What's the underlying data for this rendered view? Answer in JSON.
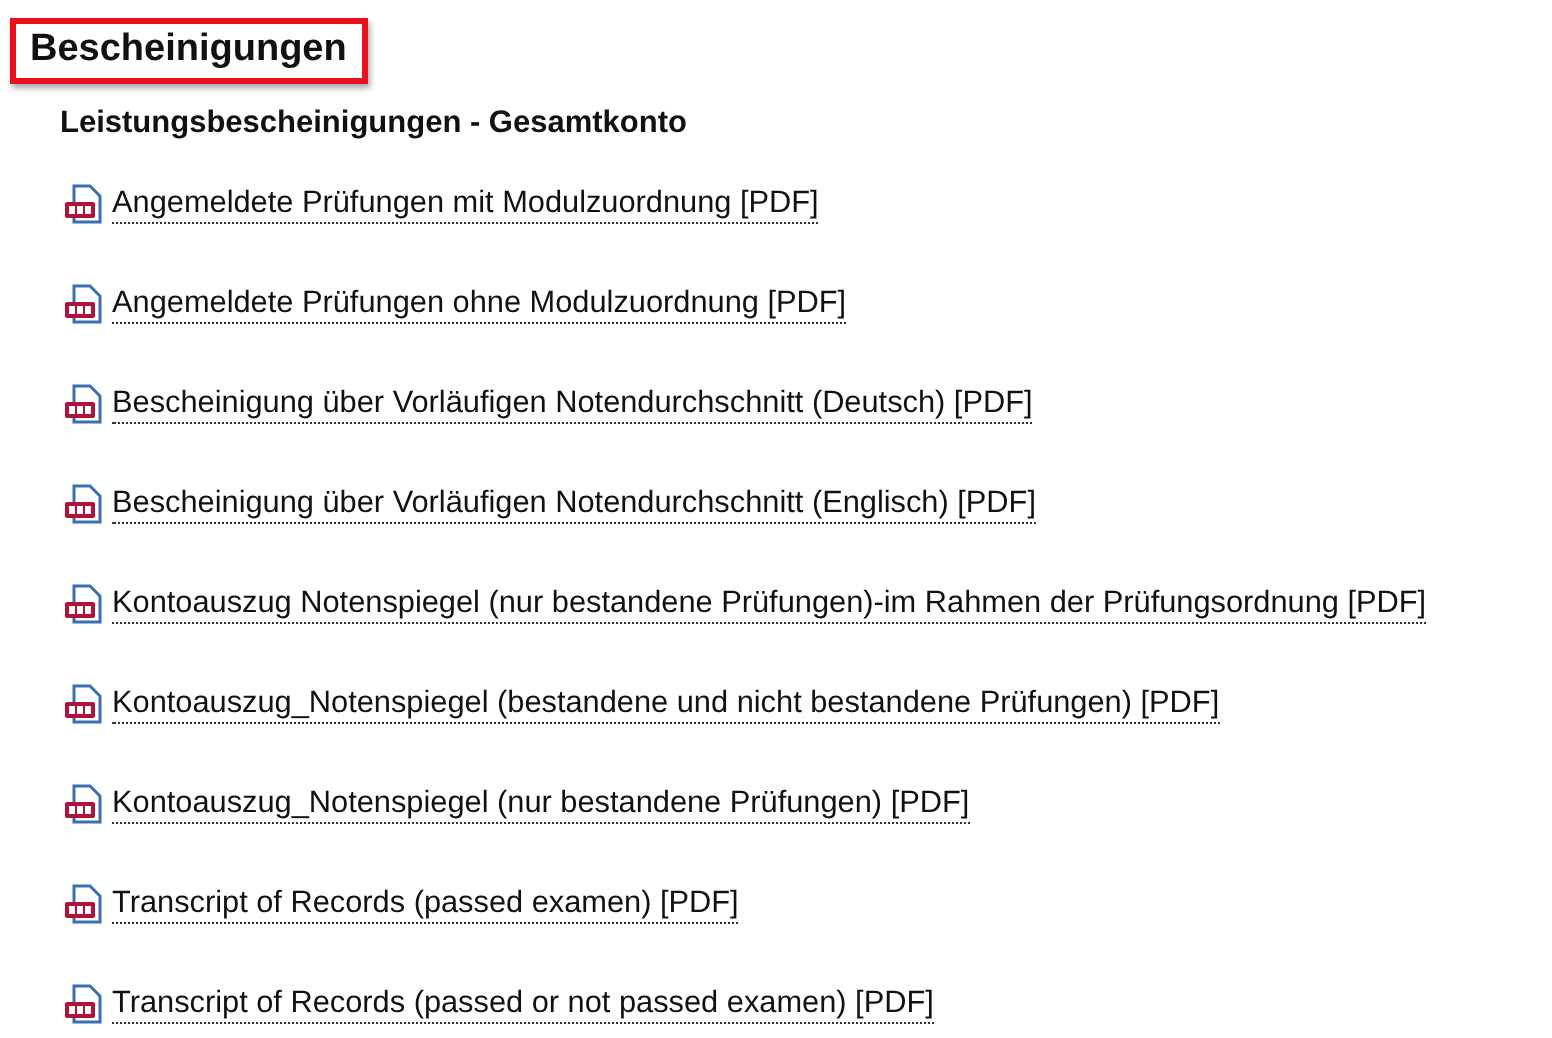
{
  "title": "Bescheinigungen",
  "section": {
    "heading": "Leistungsbescheinigungen - Gesamtkonto",
    "links": [
      {
        "label": "Angemeldete Prüfungen mit Modulzuordnung [PDF]"
      },
      {
        "label": "Angemeldete Prüfungen ohne Modulzuordnung [PDF]"
      },
      {
        "label": "Bescheinigung über Vorläufigen Notendurchschnitt (Deutsch) [PDF]"
      },
      {
        "label": "Bescheinigung über Vorläufigen Notendurchschnitt (Englisch) [PDF]"
      },
      {
        "label": "Kontoauszug Notenspiegel (nur bestandene Prüfungen)-im Rahmen der Prüfungsordnung [PDF]"
      },
      {
        "label": "Kontoauszug_Notenspiegel (bestandene und nicht bestandene Prüfungen) [PDF]"
      },
      {
        "label": "Kontoauszug_Notenspiegel (nur bestandene Prüfungen) [PDF]"
      },
      {
        "label": "Transcript of Records (passed examen) [PDF]"
      },
      {
        "label": "Transcript of Records (passed or not passed examen) [PDF]"
      }
    ]
  }
}
